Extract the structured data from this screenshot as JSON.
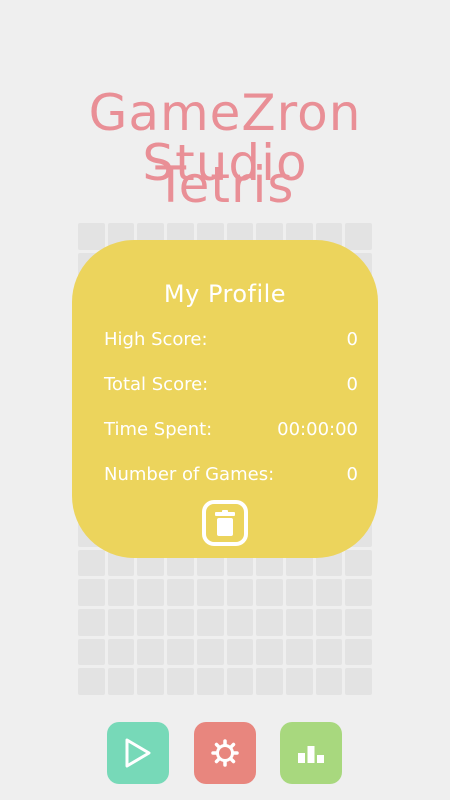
{
  "header": {
    "title_line1": "GameZron Studio",
    "title_line2": "Tetris"
  },
  "profile": {
    "heading": "My Profile",
    "rows": [
      {
        "label": "High Score:",
        "value": "0"
      },
      {
        "label": "Total Score:",
        "value": "0"
      },
      {
        "label": "Time Spent:",
        "value": "00:00:00"
      },
      {
        "label": "Number of Games:",
        "value": "0"
      }
    ],
    "delete_icon": "trash-icon"
  },
  "board": {
    "columns": 10,
    "rows": 16
  },
  "controls": [
    {
      "name": "play",
      "icon": "play-icon",
      "color": "#77d9b8"
    },
    {
      "name": "settings",
      "icon": "gear-icon",
      "color": "#e8867e"
    },
    {
      "name": "stats",
      "icon": "bar-chart-icon",
      "color": "#a8d87e"
    }
  ],
  "colors": {
    "background": "#efefef",
    "title": "#e98f96",
    "card": "#ecd45c",
    "cell": "#e3e3e3"
  }
}
